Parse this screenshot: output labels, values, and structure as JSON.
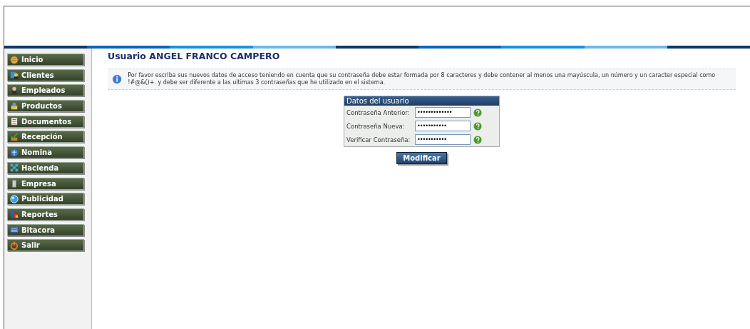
{
  "sidebar": {
    "items": [
      {
        "label": "Inicio"
      },
      {
        "label": "Clientes"
      },
      {
        "label": "Empleados"
      },
      {
        "label": "Productos"
      },
      {
        "label": "Documentos"
      },
      {
        "label": "Recepción"
      },
      {
        "label": "Nomina"
      },
      {
        "label": "Hacienda"
      },
      {
        "label": "Empresa"
      },
      {
        "label": "Publicidad"
      },
      {
        "label": "Reportes"
      },
      {
        "label": "Bitacora"
      },
      {
        "label": "Salir"
      }
    ]
  },
  "page_title": "Usuario ANGEL FRANCO CAMPERO",
  "info_message": "Por favor escriba sus nuevos datos de acceso teniendo en cuenta que su contraseña debe estar formada por 8 caracteres y debe contener al menos una mayúscula, un número y un caracter especial como !#@&()+. y debe ser diferente a las ultimas 3 contraseñas que he utilizado en el sistema.",
  "form": {
    "title": "Datos del usuario",
    "fields": [
      {
        "label": "Contraseña Anterior:",
        "value": "•••••••••••••"
      },
      {
        "label": "Contraseña Nueva:",
        "value": "•••••••••••"
      },
      {
        "label": "Verificar Contraseña:",
        "value": "•••••••••••"
      }
    ],
    "button": "Modificar"
  }
}
